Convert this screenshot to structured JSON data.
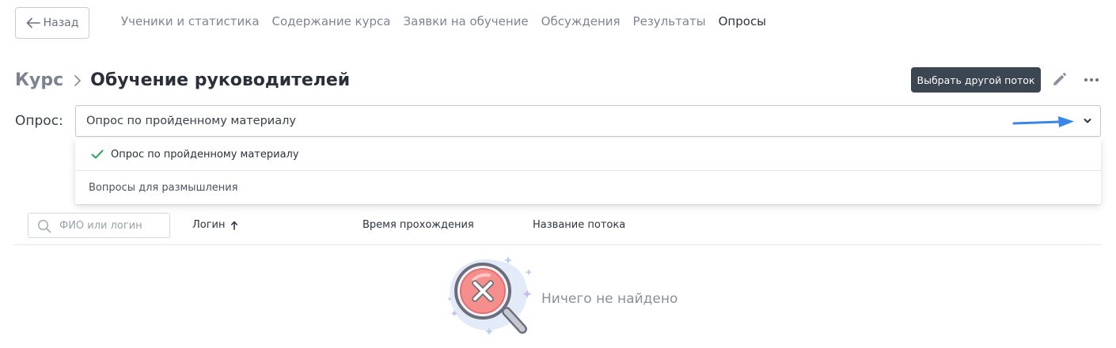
{
  "header": {
    "back_label": "Назад",
    "tabs": [
      {
        "label": "Ученики и статистика",
        "active": false
      },
      {
        "label": "Содержание курса",
        "active": false
      },
      {
        "label": "Заявки на обучение",
        "active": false
      },
      {
        "label": "Обсуждения",
        "active": false
      },
      {
        "label": "Результаты",
        "active": false
      },
      {
        "label": "Опросы",
        "active": true
      }
    ]
  },
  "breadcrumb": {
    "root": "Курс",
    "title": "Обучение руководителей"
  },
  "actions": {
    "switch_stream_label": "Выбрать другой поток"
  },
  "survey": {
    "label": "Опрос:",
    "selected_value": "Опрос по пройденному материалу",
    "options": [
      {
        "label": "Опрос по пройденному материалу",
        "selected": true
      },
      {
        "label": "Вопросы для размышления",
        "selected": false
      }
    ]
  },
  "table": {
    "search_placeholder": "ФИО или логин",
    "columns": [
      {
        "label": "Логин",
        "sort": "asc"
      },
      {
        "label": "Время прохождения"
      },
      {
        "label": "Название потока"
      }
    ]
  },
  "empty_state": {
    "text": "Ничего не найдено"
  },
  "colors": {
    "primary_dark": "#3c4552",
    "annotation_arrow": "#3a86e8",
    "check_green": "#22a455",
    "muted_text": "#7e8593"
  },
  "icons": {
    "back": "arrow-left-icon",
    "breadcrumb_sep": "chevron-right-icon",
    "edit": "pencil-icon",
    "more": "more-horizontal-icon",
    "dropdown": "chevron-down-icon",
    "selected": "check-icon",
    "search": "search-icon",
    "sort": "arrow-up-icon",
    "empty": "magnifier-x-icon"
  }
}
